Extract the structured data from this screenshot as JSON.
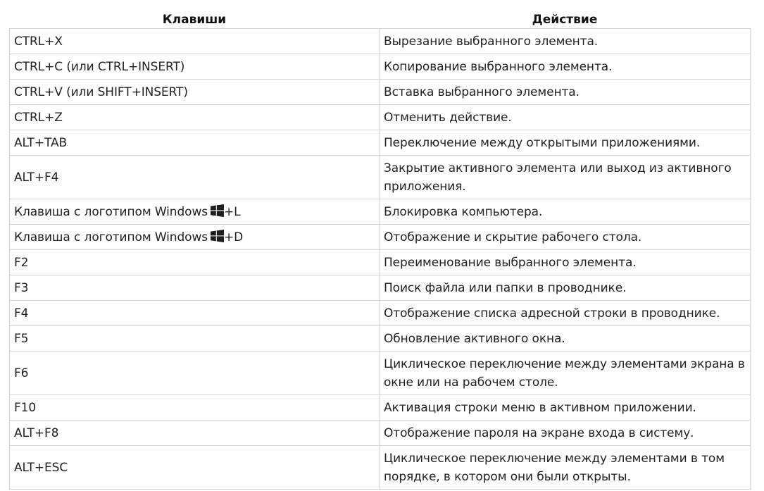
{
  "table": {
    "headers": {
      "keys": "Клавиши",
      "action": "Действие"
    },
    "rows": [
      {
        "keys": "CTRL+X",
        "action": "Вырезание выбранного элемента."
      },
      {
        "keys": "CTRL+C (или CTRL+INSERT)",
        "action": "Копирование выбранного элемента."
      },
      {
        "keys": "CTRL+V (или SHIFT+INSERT)",
        "action": "Вставка выбранного элемента."
      },
      {
        "keys": "CTRL+Z",
        "action": "Отменить действие."
      },
      {
        "keys": "ALT+TAB",
        "action": "Переключение между открытыми приложениями."
      },
      {
        "keys": "ALT+F4",
        "action": "Закрытие активного элемента или выход из активного приложения."
      },
      {
        "keys": "Клавиша с логотипом Windows",
        "keys_suffix": "+L",
        "icon": "windows-logo-icon",
        "action": "Блокировка компьютера."
      },
      {
        "keys": "Клавиша с логотипом Windows",
        "keys_suffix": "+D",
        "icon": "windows-logo-icon",
        "action": "Отображение и скрытие рабочего стола."
      },
      {
        "keys": "F2",
        "action": "Переименование выбранного элемента."
      },
      {
        "keys": "F3",
        "action": "Поиск файла или папки в проводнике."
      },
      {
        "keys": "F4",
        "action": "Отображение списка адресной строки в проводнике."
      },
      {
        "keys": "F5",
        "action": "Обновление активного окна."
      },
      {
        "keys": "F6",
        "action": "Циклическое переключение между элементами экрана в окне или на рабочем столе."
      },
      {
        "keys": "F10",
        "action": "Активация строки меню в активном приложении."
      },
      {
        "keys": "ALT+F8",
        "action": "Отображение пароля на экране входа в систему."
      },
      {
        "keys": "ALT+ESC",
        "action": "Циклическое переключение между элементами в том порядке, в котором они были открыты."
      }
    ]
  }
}
